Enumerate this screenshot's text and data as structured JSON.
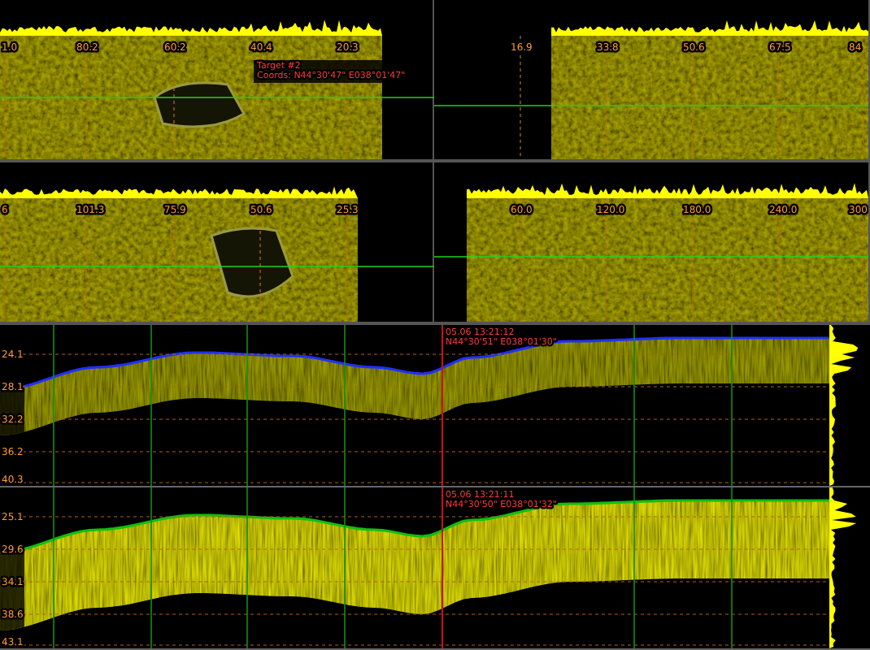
{
  "sidescan_panels": [
    {
      "ticks": [
        "1.0",
        "80.2",
        "60.2",
        "40.4",
        "20.3"
      ],
      "target_labels": [
        "Target #2",
        "Coords: N44°30'47\" E038°01'47\""
      ]
    },
    {
      "ticks": [
        "16.9",
        "33.8",
        "50.6",
        "67.5",
        "84"
      ]
    },
    {
      "ticks": [
        "6",
        "101.3",
        "75.9",
        "50.6",
        "25.3"
      ]
    },
    {
      "ticks": [
        "60.0",
        "120.0",
        "180.0",
        "240.0",
        "300"
      ]
    }
  ],
  "profile_panels": [
    {
      "kind": "bottom_line",
      "depth_ticks": [
        "24.1",
        "28.1",
        "32.2",
        "36.2",
        "40.3"
      ],
      "cursor_labels": [
        "05.06 13:21:12",
        "N44°30'51\" E038°01'30\""
      ]
    },
    {
      "kind": "filled",
      "depth_ticks": [
        "25.1",
        "29.6",
        "34.1",
        "38.6",
        "43.1"
      ],
      "cursor_labels": [
        "05.06 13:21:11",
        "N44°30'50\" E038°01'32\""
      ]
    }
  ]
}
